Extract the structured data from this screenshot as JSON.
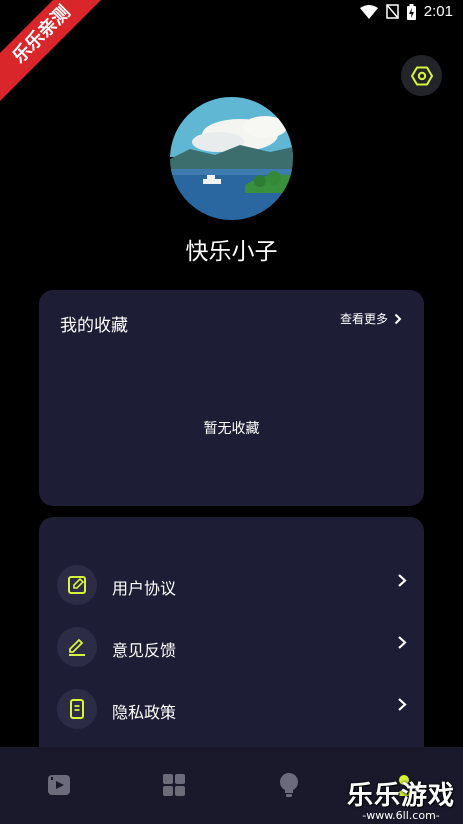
{
  "status_bar": {
    "time": "2:01"
  },
  "badge": {
    "text": "乐乐亲测"
  },
  "profile": {
    "username": "快乐小子"
  },
  "favorites": {
    "title": "我的收藏",
    "more_label": "查看更多",
    "empty_text": "暂无收藏"
  },
  "menu": {
    "items": [
      {
        "label": "用户协议",
        "icon": "document-edit-icon"
      },
      {
        "label": "意见反馈",
        "icon": "pen-icon"
      },
      {
        "label": "隐私政策",
        "icon": "receipt-icon"
      }
    ]
  },
  "tabs": [
    {
      "icon": "video-icon"
    },
    {
      "icon": "grid-icon"
    },
    {
      "icon": "lightbulb-icon"
    },
    {
      "icon": "profile-icon"
    }
  ],
  "watermark": {
    "title": "乐乐游戏",
    "url": "-www.6ll.com-"
  },
  "colors": {
    "accent": "#d7f33a",
    "card": "#1d1d35",
    "tabbar": "#19192b",
    "badge": "#d9262b"
  }
}
